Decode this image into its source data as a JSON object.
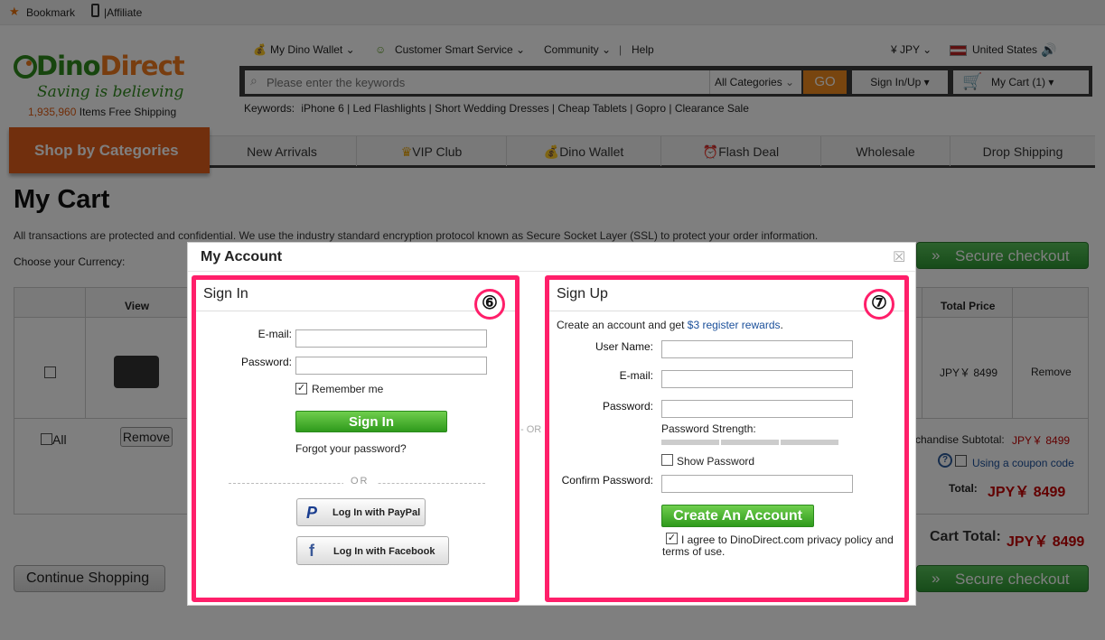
{
  "topbar": {
    "bookmark": "Bookmark",
    "affiliate": "|Affiliate"
  },
  "logo": {
    "brand_part1": "Dino",
    "brand_part2": "Direct",
    "slogan": "Saving is believing",
    "shipping_count": "1,935,960",
    "shipping_text": "Items Free Shipping"
  },
  "topnav": {
    "wallet": "My Dino Wallet",
    "smart_service": "Customer Smart Service",
    "community": "Community",
    "sep": "|",
    "help": "Help",
    "currency": "¥ JPY",
    "country": "United States"
  },
  "search": {
    "placeholder": "Please enter the keywords",
    "category": "All Categories",
    "go": "GO",
    "signin": "Sign In/Up",
    "cart": "My Cart (1)"
  },
  "keywords": {
    "label": "Keywords:",
    "items": [
      "iPhone 6",
      "Led Flashlights",
      "Short Wedding Dresses",
      "Cheap Tablets",
      "Gopro",
      "Clearance Sale"
    ]
  },
  "catnav": {
    "shop_by": "Shop by Categories",
    "items": [
      "New Arrivals",
      "VIP Club",
      "Dino Wallet",
      "Flash Deal",
      "Wholesale",
      "Drop Shipping"
    ]
  },
  "cart": {
    "title": "My Cart",
    "ssl_note": "All transactions are protected and confidential. We use the industry standard encryption protocol known as Secure Socket Layer (SSL) to protect your order information.",
    "currency_label": "Choose your Currency:",
    "col_view": "View",
    "col_total": "Total Price",
    "row_total": "JPY￥ 8499",
    "row_remove": "Remove",
    "all_label": "All",
    "remove_btn": "Remove",
    "subtotal_label": "chandise Subtotal:",
    "subtotal_value": "JPY￥ 8499",
    "coupon": "Using a coupon code",
    "total_label": "Total:",
    "total_value": "JPY￥ 8499",
    "cart_total_label": "Cart Total:",
    "cart_total_value": "JPY￥ 8499",
    "secure_checkout": "Secure checkout",
    "continue": "Continue Shopping"
  },
  "modal": {
    "title": "My Account",
    "close": "☒",
    "or_middle": "OR",
    "signin": {
      "title": "Sign In",
      "badge": "⑥",
      "email_label": "E-mail:",
      "password_label": "Password:",
      "remember": "Remember me",
      "button": "Sign In",
      "forgot": "Forgot your password?",
      "or": "OR",
      "paypal": "Log In with PayPal",
      "facebook": "Log In with Facebook"
    },
    "signup": {
      "title": "Sign Up",
      "badge": "⑦",
      "intro_prefix": "Create an account and get ",
      "intro_link": "$3 register rewards",
      "intro_suffix": ".",
      "username_label": "User Name:",
      "email_label": "E-mail:",
      "password_label": "Password:",
      "strength_label": "Password Strength:",
      "show_password": "Show Password",
      "confirm_label": "Confirm Password:",
      "button": "Create An Account",
      "agree": "I agree to DinoDirect.com privacy policy and terms of use."
    }
  },
  "colors": {
    "accent_orange": "#e25f1b",
    "green": "#2f9a1c",
    "highlight": "#ff1f6a",
    "price_red": "#c40000"
  }
}
